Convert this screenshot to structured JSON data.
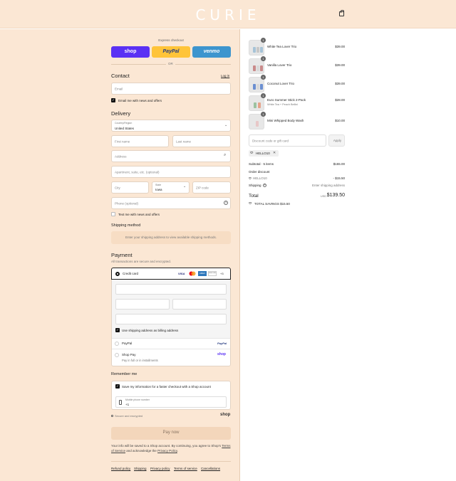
{
  "header": {
    "logo": "CURIE"
  },
  "express": {
    "title": "Express checkout",
    "shop": "shop",
    "paypal": "PayPal",
    "venmo": "venmo",
    "or": "OR"
  },
  "contact": {
    "title": "Contact",
    "login": "Log in",
    "email_placeholder": "Email",
    "news_label": "Email me with news and offers"
  },
  "delivery": {
    "title": "Delivery",
    "country_label": "Country/Region",
    "country_value": "United States",
    "first_name": "First name",
    "last_name": "Last name",
    "address": "Address",
    "apartment": "Apartment, suite, etc. (optional)",
    "city": "City",
    "state_label": "State",
    "state_value": "Iowa",
    "zip": "ZIP code",
    "phone": "Phone (optional)",
    "text_label": "Text me with news and offers"
  },
  "shipping": {
    "title": "Shipping method",
    "note": "Enter your shipping address to view available shipping methods."
  },
  "payment": {
    "title": "Payment",
    "subtitle": "All transactions are secure and encrypted.",
    "credit_card": "Credit card",
    "visa": "VISA",
    "amex": "AMEX",
    "discover": "DISCOVER",
    "more": "+3",
    "billing_label": "Use shipping address as billing address",
    "paypal": "PayPal",
    "paypal_logo": "PayPal",
    "shoppay": "Shop Pay",
    "shoppay_sub": "Pay in full or in installments",
    "shoppay_logo": "shop"
  },
  "remember": {
    "title": "Remember me",
    "save_label": "Save my information for a faster checkout with a Shop account",
    "mobile_label": "Mobile phone number",
    "mobile_value": "+1",
    "secure": "Secure and encrypted",
    "shop_logo": "shop"
  },
  "pay_now": "Pay now",
  "legal": {
    "part1": "Your info will be saved to a Shop account. By continuing, you agree to Shop's",
    "tos": "Terms of Service",
    "part2": "and acknowledge the",
    "privacy": "Privacy Policy",
    "end": "."
  },
  "footer": [
    "Refund policy",
    "Shipping",
    "Privacy policy",
    "Terms of service",
    "Cancellations"
  ],
  "cart": {
    "items": [
      {
        "name": "White Tea Lover Trio",
        "sub": "",
        "price": "$39.00",
        "qty": "1"
      },
      {
        "name": "Vanilla Lover Trio",
        "sub": "",
        "price": "$39.00",
        "qty": "1"
      },
      {
        "name": "Coconut Lover Trio",
        "sub": "",
        "price": "$39.00",
        "qty": "1"
      },
      {
        "name": "Euro Summer Stick 2-Pack",
        "sub": "White Tea + Peach Bellini",
        "price": "$28.00",
        "qty": "1"
      },
      {
        "name": "Mini Whipped Body Wash",
        "sub": "",
        "price": "$10.00",
        "qty": "1"
      }
    ],
    "discount_placeholder": "Discount code or gift card",
    "apply": "Apply",
    "code": "HELLO10",
    "subtotal_label": "Subtotal · 5 items",
    "subtotal": "$155.00",
    "order_discount": "Order discount",
    "discount_code": "HELLO10",
    "discount_amount": "- $15.50",
    "shipping_label": "Shipping",
    "shipping_value": "Enter shipping address",
    "total_label": "Total",
    "currency": "USD",
    "total": "$139.50",
    "savings": "TOTAL SAVINGS $15.50"
  },
  "colors": {
    "bg": "#fbe7d4",
    "shop": "#5a31f4",
    "paypal": "#ffc439",
    "venmo": "#3d95ce"
  }
}
